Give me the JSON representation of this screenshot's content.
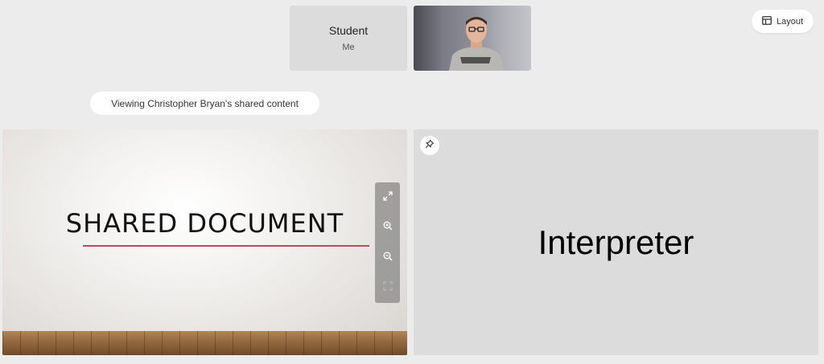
{
  "participants": [
    {
      "name": "Student",
      "subtitle": "Me"
    }
  ],
  "toolbar": {
    "layout_label": "Layout"
  },
  "share": {
    "viewing_text": "Viewing Christopher Bryan's shared content",
    "document_title": "SHARED DOCUMENT"
  },
  "interpreter": {
    "label": "Interpreter"
  },
  "icons": {
    "layout": "layout-icon",
    "expand": "expand-icon",
    "zoom_in": "zoom-in-icon",
    "zoom_out": "zoom-out-icon",
    "fit": "fit-screen-icon",
    "pin": "pin-icon"
  },
  "colors": {
    "background": "#ececec",
    "title_underline": "#c0485a"
  }
}
